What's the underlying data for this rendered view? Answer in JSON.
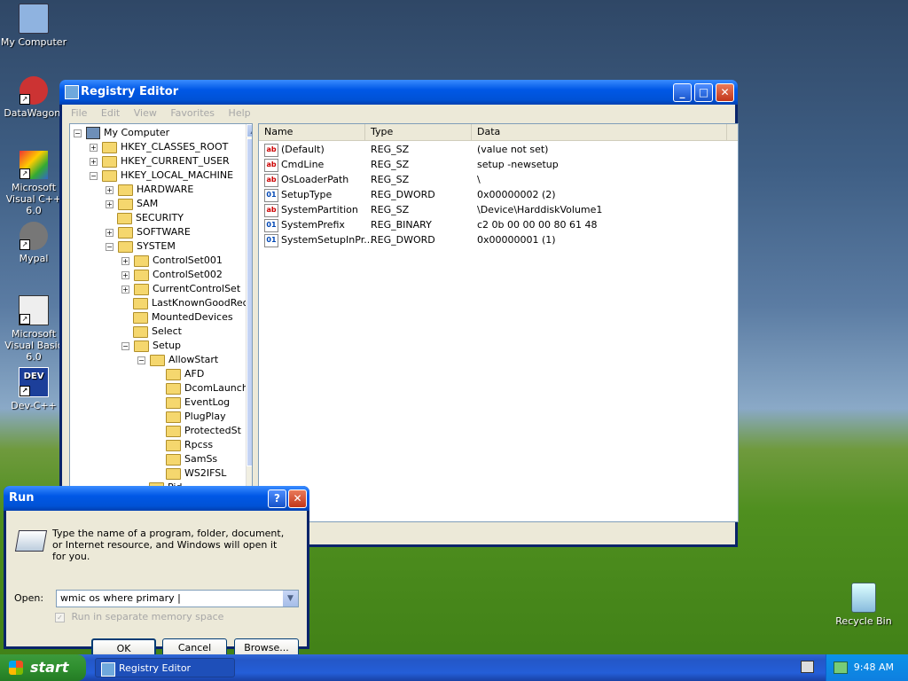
{
  "desktop": {
    "icons": [
      {
        "label": "My Computer",
        "icon": "computer-icon"
      },
      {
        "label": "DataWagon.",
        "icon": "shortcut-icon"
      },
      {
        "label": "Microsoft Visual C++ 6.0",
        "icon": "vc-icon"
      },
      {
        "label": "Mypal",
        "icon": "raccoon-icon"
      },
      {
        "label": "Microsoft Visual Basic 6.0",
        "icon": "vb-icon"
      },
      {
        "label": "Dev-C++",
        "icon": "dev-icon"
      },
      {
        "label": "Recycle Bin",
        "icon": "recycle-bin-icon"
      }
    ]
  },
  "registry": {
    "title": "Registry Editor",
    "menu": [
      "File",
      "Edit",
      "View",
      "Favorites",
      "Help"
    ],
    "tree": {
      "root": "My Computer",
      "hkcr": "HKEY_CLASSES_ROOT",
      "hkcu": "HKEY_CURRENT_USER",
      "hklm": "HKEY_LOCAL_MACHINE",
      "hardware": "HARDWARE",
      "sam": "SAM",
      "security": "SECURITY",
      "software": "SOFTWARE",
      "system": "SYSTEM",
      "cs1": "ControlSet001",
      "cs2": "ControlSet002",
      "ccs": "CurrentControlSet",
      "lkg": "LastKnownGoodRec",
      "mounted": "MountedDevices",
      "select": "Select",
      "setup": "Setup",
      "allowstart": "AllowStart",
      "afd": "AFD",
      "dcom": "DcomLaunch",
      "eventlog": "EventLog",
      "plugplay": "PlugPlay",
      "protected": "ProtectedSt",
      "rpcss": "Rpcss",
      "samss": "SamSs",
      "ws2": "WS2IFSL",
      "pid": "Pid"
    },
    "columns": {
      "name": "Name",
      "type": "Type",
      "data": "Data"
    },
    "values": [
      {
        "name": "(Default)",
        "type": "REG_SZ",
        "data": "(value not set)"
      },
      {
        "name": "CmdLine",
        "type": "REG_SZ",
        "data": "setup -newsetup"
      },
      {
        "name": "OsLoaderPath",
        "type": "REG_SZ",
        "data": "\\"
      },
      {
        "name": "SetupType",
        "type": "REG_DWORD",
        "data": "0x00000002 (2)"
      },
      {
        "name": "SystemPartition",
        "type": "REG_SZ",
        "data": "\\Device\\HarddiskVolume1"
      },
      {
        "name": "SystemPrefix",
        "type": "REG_BINARY",
        "data": "c2 0b 00 00 00 80 61 48"
      },
      {
        "name": "SystemSetupInPr...",
        "type": "REG_DWORD",
        "data": "0x00000001 (1)"
      }
    ]
  },
  "run": {
    "title": "Run",
    "help_glyph": "?",
    "close_glyph": "✕",
    "description": "Type the name of a program, folder, document, or Internet resource, and Windows will open it for you.",
    "open_label": "Open:",
    "open_value": "wmic os where primary |",
    "separate_memory": "Run in separate memory space",
    "ok": "OK",
    "cancel": "Cancel",
    "browse": "Browse..."
  },
  "taskbar": {
    "start": "start",
    "task": "Registry Editor",
    "clock": "9:48 AM"
  }
}
